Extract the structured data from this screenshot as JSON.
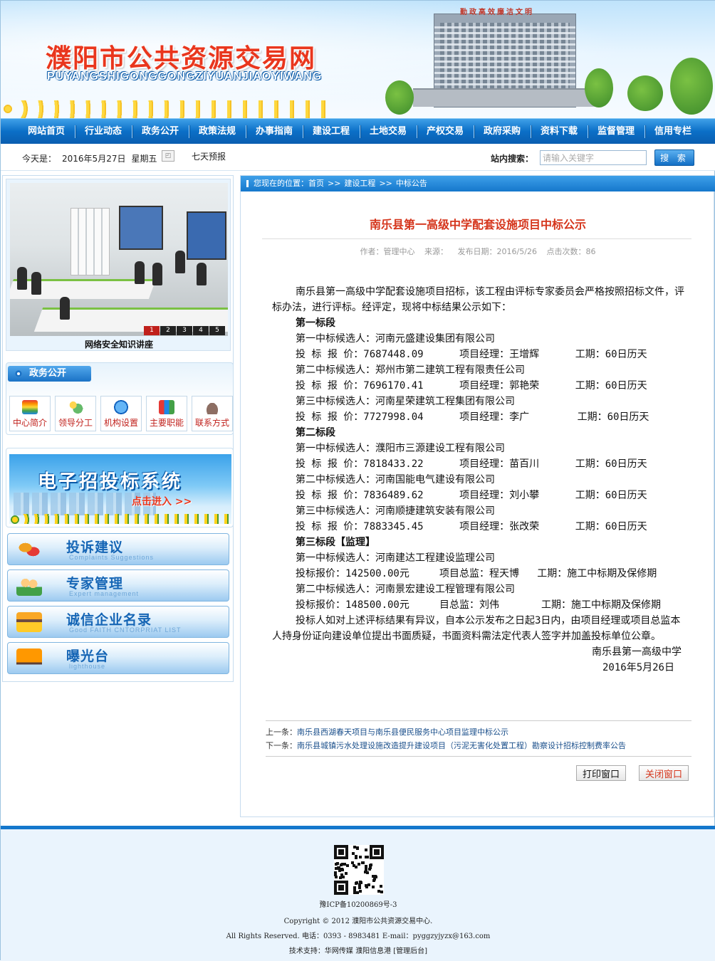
{
  "header": {
    "site_title": "濮阳市公共资源交易网",
    "site_title_en": "PUYANGSHIGONGGONGZIYUANJIAOYIWANG",
    "building_sign": "勤政高效廉洁文明"
  },
  "nav": {
    "items": [
      "网站首页",
      "行业动态",
      "政务公开",
      "政策法规",
      "办事指南",
      "建设工程",
      "土地交易",
      "产权交易",
      "政府采购",
      "资料下载",
      "监督管理",
      "信用专栏"
    ]
  },
  "infobar": {
    "today_label": "今天是：",
    "date": "2016年5月27日",
    "weekday": "星期五",
    "forecast": "七天预报",
    "search_label": "站内搜索：",
    "search_placeholder": "请输入关键字",
    "search_button": "搜 索"
  },
  "sidebar": {
    "slide_caption": "网络安全知识讲座",
    "slide_pages": [
      "1",
      "2",
      "3",
      "4",
      "5"
    ],
    "gov_title": "政务公开",
    "gov_items": [
      "中心简介",
      "领导分工",
      "机构设置",
      "主要职能",
      "联系方式"
    ],
    "banner_title": "电子招投标系统",
    "banner_sub": "点击进入 >>",
    "links": [
      {
        "cn": "投诉建议",
        "en": "Complaints Suggestions"
      },
      {
        "cn": "专家管理",
        "en": "Expert management"
      },
      {
        "cn": "诚信企业名录",
        "en": "Good FAITH CNTORPRIAT LIST"
      },
      {
        "cn": "曝光台",
        "en": "lighthouse"
      }
    ]
  },
  "breadcrumb": {
    "prefix": "您现在的位置：",
    "home": "首页",
    "sep": ">>",
    "level1": "建设工程",
    "level2": "中标公告"
  },
  "article": {
    "title": "南乐县第一高级中学配套设施项目中标公示",
    "author": "作者：管理中心",
    "source": "来源：",
    "date": "发布日期：2016/5/26",
    "views": "点击次数：86",
    "intro": "南乐县第一高级中学配套设施项目招标，该工程由评标专家委员会严格按照招标文件，评标办法，进行评标。经评定，现将中标结果公示如下：",
    "lines": [
      {
        "t": "第一标段",
        "b": true
      },
      {
        "t": "第一中标候选人：河南元盛建设集团有限公司"
      },
      {
        "t": "投 标 报 价：7687448.09      项目经理：王增辉      工期：60日历天"
      },
      {
        "t": "第二中标候选人：郑州市第二建筑工程有限责任公司"
      },
      {
        "t": "投 标 报 价：7696170.41      项目经理：郭艳荣      工期：60日历天"
      },
      {
        "t": "第三中标候选人：河南星荣建筑工程集团有限公司"
      },
      {
        "t": "投 标 报 价：7727998.04      项目经理：李广        工期：60日历天"
      },
      {
        "t": "第二标段",
        "b": true
      },
      {
        "t": "第一中标候选人：濮阳市三源建设工程有限公司"
      },
      {
        "t": "投 标 报 价：7818433.22      项目经理：苗百川      工期：60日历天"
      },
      {
        "t": "第二中标候选人：河南国能电气建设有限公司"
      },
      {
        "t": "投 标 报 价：7836489.62      项目经理：刘小攀      工期：60日历天"
      },
      {
        "t": "第三中标候选人：河南顺捷建筑安装有限公司"
      },
      {
        "t": "投 标 报 价：7883345.45      项目经理：张改荣      工期：60日历天"
      },
      {
        "t": "第三标段【监理】",
        "b": true
      },
      {
        "t": "第一中标候选人：河南建达工程建设监理公司"
      },
      {
        "t": "投标报价：142500.00元     项目总监：程天博   工期：施工中标期及保修期"
      },
      {
        "t": "第二中标候选人：河南景宏建设工程管理有限公司"
      },
      {
        "t": "投标报价：148500.00元     目总监：刘伟       工期：施工中标期及保修期"
      }
    ],
    "closing": "投标人如对上述评标结果有异议，自本公示发布之日起3日内，由项目经理或项目总监本人持身份证向建设单位提出书面质疑，书面资料需法定代表人签字并加盖投标单位公章。",
    "signature": "南乐县第一高级中学",
    "sign_date": "2016年5月26日",
    "prev_label": "上一条：",
    "prev_title": "南乐县西湖春天项目与南乐县便民服务中心项目监理中标公示",
    "next_label": "下一条：",
    "next_title": "南乐县城镇污水处理设施改造提升建设项目（污泥无害化处置工程）勘察设计招标控制费率公告",
    "print_button": "打印窗口",
    "close_button": "关闭窗口"
  },
  "footer": {
    "icp": "豫ICP备10200869号-3",
    "copyright": "Copyright © 2012 濮阳市公共资源交易中心.",
    "rights": "All Rights Reserved. 电话：0393 - 8983481 E-mail：pyggzyjyzx@163.com",
    "support": "技术支持：华网传媒 濮阳信息港 [管理后台]"
  },
  "colors": {
    "nav_blue": "#0b6fc7",
    "title_red": "#d5351c",
    "accent_red": "#c0201b"
  }
}
